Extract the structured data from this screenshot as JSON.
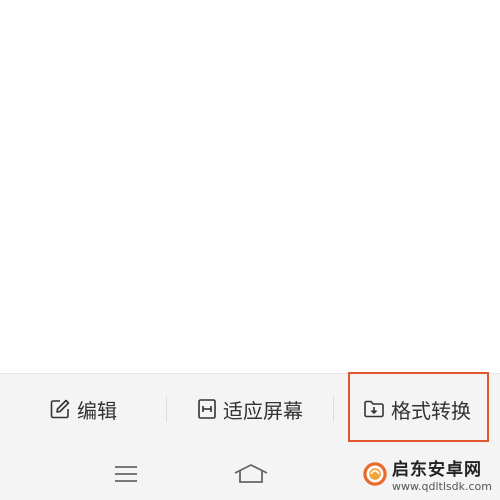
{
  "toolbar": {
    "edit_label": "编辑",
    "fit_screen_label": "适应屏幕",
    "format_convert_label": "格式转换"
  },
  "watermark": {
    "title": "启东安卓网",
    "url": "www.qdltlsdk.com"
  },
  "colors": {
    "highlight": "#e2572f",
    "panel_background": "#f4f4f4",
    "text": "#333333"
  },
  "icons": [
    "edit-icon",
    "fit-screen-icon",
    "folder-download-icon",
    "menu-icon",
    "home-icon",
    "logo-icon"
  ]
}
